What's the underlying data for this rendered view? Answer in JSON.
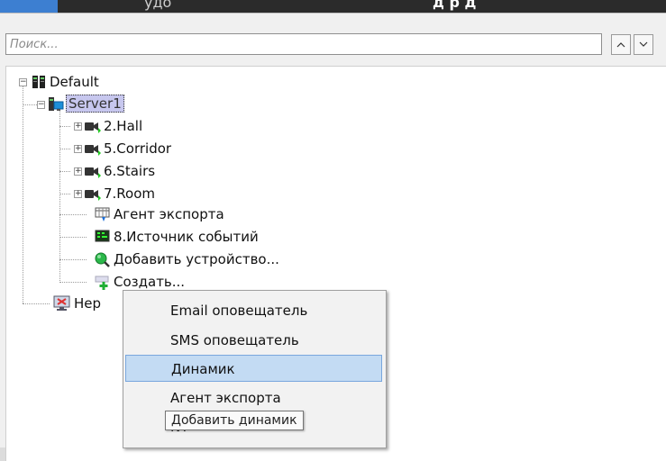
{
  "header": {
    "left_text": "удо",
    "right_text": "д   р    д"
  },
  "search": {
    "placeholder": "Поиск..."
  },
  "nav": {
    "up_icon": "chevron-up-icon",
    "down_icon": "chevron-down-icon",
    "up": "^",
    "down": "v"
  },
  "tree": {
    "root": "Default",
    "server": "Server1",
    "items": [
      "2.Hall",
      "5.Corridor",
      "6.Stairs",
      "7.Room",
      "Агент экспорта",
      "8.Источник событий",
      "Добавить устройство...",
      "Создать..."
    ],
    "unassigned": "Нер"
  },
  "context_menu": {
    "items": [
      "Email оповещатель",
      "SMS оповещатель",
      "Динамик",
      "Агент экспорта",
      "NT"
    ],
    "highlighted_index": 2
  },
  "tooltip": "Добавить динамик",
  "colors": {
    "selection": "#c7c7ee",
    "menu_highlight": "#c3dbf3",
    "menu_highlight_border": "#79a7dd"
  }
}
